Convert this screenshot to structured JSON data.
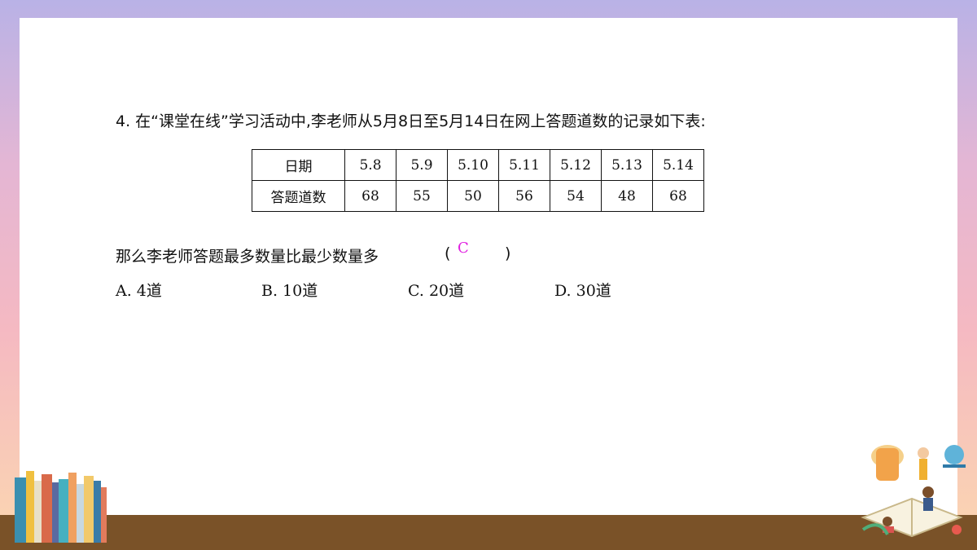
{
  "question": {
    "text": "4. 在“课堂在线”学习活动中,李老师从5月8日至5月14日在网上答题道数的记录如下表:"
  },
  "table": {
    "row_headers": [
      "日期",
      "答题道数"
    ],
    "dates": [
      "5.8",
      "5.9",
      "5.10",
      "5.11",
      "5.12",
      "5.13",
      "5.14"
    ],
    "counts": [
      "68",
      "55",
      "50",
      "56",
      "54",
      "48",
      "68"
    ]
  },
  "prompt": {
    "text": "那么李老师答题最多数量比最少数量多",
    "paren_open": "(",
    "paren_close": ")",
    "answer": "C",
    "answer_color": "#e020e0"
  },
  "options": [
    "A. 4道",
    "B. 10道",
    "C. 20道",
    "D. 30道"
  ],
  "decor": {
    "left": "books-illustration",
    "right": "open-book-reading-illustration",
    "floor_color": "#7a5228"
  }
}
